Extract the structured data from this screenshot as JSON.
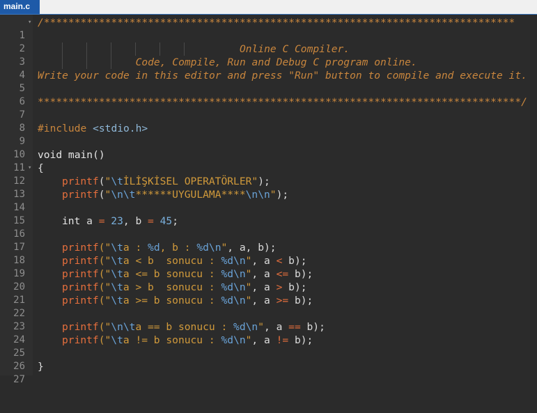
{
  "tab": {
    "label": "main.c"
  },
  "editor": {
    "line_numbers": [
      "1",
      "2",
      "3",
      "4",
      "5",
      "6",
      "7",
      "8",
      "9",
      "10",
      "11",
      "12",
      "13",
      "14",
      "15",
      "16",
      "17",
      "18",
      "19",
      "20",
      "21",
      "22",
      "23",
      "24",
      "25",
      "26",
      "27"
    ],
    "fold_glyph": "▾",
    "lines": {
      "l1": "/*****************************************************************************",
      "l3": "                                 Online C Compiler.",
      "l4": "                Code, Compile, Run and Debug C program online.",
      "l5": "Write your code in this editor and press \"Run\" button to compile and execute it.",
      "l7": "*******************************************************************************/",
      "l9_directive": "#include",
      "l9_header": " <stdio.h>",
      "l11": "void main()",
      "l12": "{",
      "l13_fn": "printf",
      "l13_open": "(",
      "l13_q1": "\"",
      "l13_esc1": "\\t",
      "l13_text": "İLİŞKİSEL OPERATÖRLER",
      "l13_q2": "\"",
      "l13_close": ");",
      "l14_fn": "printf",
      "l14_open": "(",
      "l14_q1": "\"",
      "l14_esc1": "\\n\\t",
      "l14_text": "******UYGULAMA****",
      "l14_esc2": "\\n\\n",
      "l14_q2": "\"",
      "l14_close": ");",
      "l16_type": "int",
      "l16_a": " a ",
      "l16_eq1": "=",
      "l16_n1": " 23",
      "l16_b": ", b ",
      "l16_eq2": "=",
      "l16_n2": " 45",
      "l16_end": ";",
      "l18": {
        "fn": "printf",
        "open": "(\"",
        "e1": "\\t",
        "t1": "a : ",
        "f1": "%d",
        "t2": ", b : ",
        "f2": "%d",
        "e2": "\\n",
        "q": "\"",
        "args": ", a, b);"
      },
      "l19": {
        "fn": "printf",
        "open": "(\"",
        "e1": "\\t",
        "t1": "a < b  sonucu : ",
        "f1": "%d",
        "e2": "\\n",
        "q": "\"",
        "a1": ", a ",
        "op": "<",
        "a2": " b);"
      },
      "l20": {
        "fn": "printf",
        "open": "(\"",
        "e1": "\\t",
        "t1": "a <= b sonucu : ",
        "f1": "%d",
        "e2": "\\n",
        "q": "\"",
        "a1": ", a ",
        "op": "<=",
        "a2": " b);"
      },
      "l21": {
        "fn": "printf",
        "open": "(\"",
        "e1": "\\t",
        "t1": "a > b  sonucu : ",
        "f1": "%d",
        "e2": "\\n",
        "q": "\"",
        "a1": ", a ",
        "op": ">",
        "a2": " b);"
      },
      "l22": {
        "fn": "printf",
        "open": "(\"",
        "e1": "\\t",
        "t1": "a >= b sonucu : ",
        "f1": "%d",
        "e2": "\\n",
        "q": "\"",
        "a1": ", a ",
        "op": ">=",
        "a2": " b);"
      },
      "l24": {
        "fn": "printf",
        "open": "(\"",
        "e1": "\\n\\t",
        "t1": "a == b sonucu : ",
        "f1": "%d",
        "e2": "\\n",
        "q": "\"",
        "a1": ", a ",
        "op": "==",
        "a2": " b);"
      },
      "l25": {
        "fn": "printf",
        "open": "(\"",
        "e1": "\\t",
        "t1": "a != b sonucu : ",
        "f1": "%d",
        "e2": "\\n",
        "q": "\"",
        "a1": ", a ",
        "op": "!=",
        "a2": " b);"
      },
      "l27": "}"
    }
  },
  "colors": {
    "tab_bg": "#1e5aa8",
    "editor_bg": "#2b2b2b",
    "comment": "#c9863d",
    "function": "#e66f3d",
    "string": "#d19a3b",
    "escape": "#6aa3d8"
  }
}
